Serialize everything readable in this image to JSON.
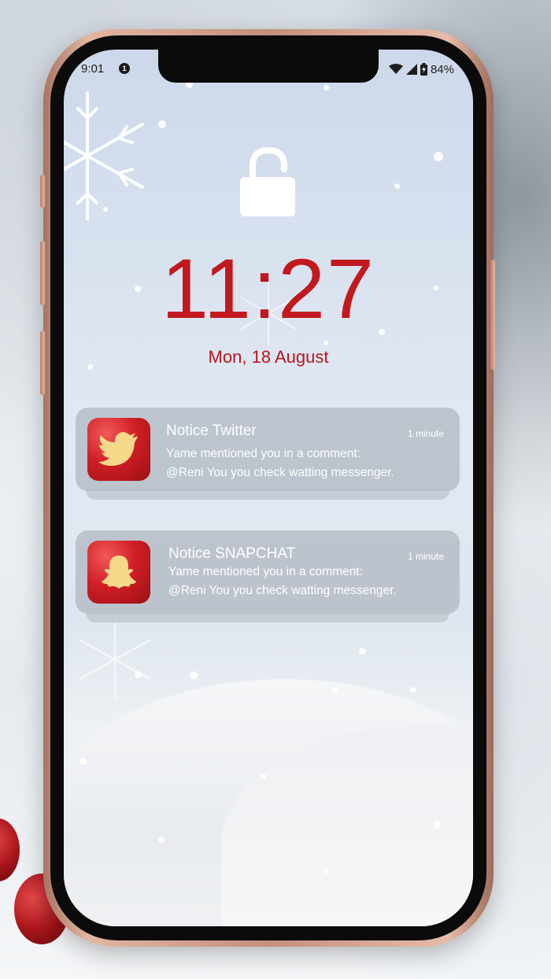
{
  "status_bar": {
    "time": "9:01",
    "badge": "1",
    "battery": "84%",
    "icons": [
      "wifi-icon",
      "signal-icon",
      "battery-icon"
    ]
  },
  "lock_screen": {
    "lock_state": "unlocked",
    "clock": "11:27",
    "date": "Mon, 18 August",
    "accent_color": "#c2181f"
  },
  "notifications": [
    {
      "app_icon": "twitter-bird-icon",
      "title": "Notice Twitter",
      "time": "1 minute",
      "line1": "Yame mentioned you in a comment:",
      "line2": "@Reni You you check watting messenger."
    },
    {
      "app_icon": "snapchat-ghost-icon",
      "title": "Notice SNAPCHAT",
      "time": "1 minute",
      "line1": "Yame mentioned you in a comment:",
      "line2": "@Reni You you check watting messenger."
    }
  ]
}
